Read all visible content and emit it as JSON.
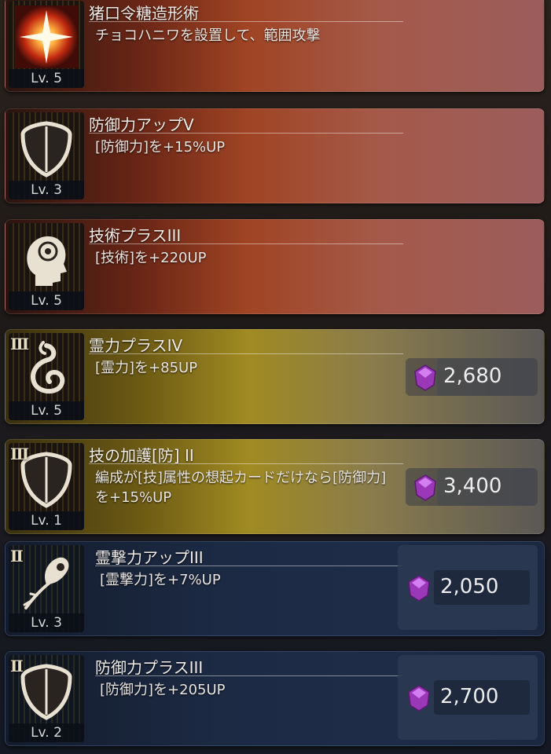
{
  "skills": [
    {
      "name": "猪口令糖造形術",
      "desc": "チョコハニワを設置して、範囲攻撃",
      "level": "Lv. 5",
      "rank": "",
      "cost": "",
      "theme": "red",
      "icon": "burst-icon"
    },
    {
      "name": "防御力アップV",
      "desc": "[防御力]を+15%UP",
      "level": "Lv. 3",
      "rank": "",
      "cost": "",
      "theme": "red",
      "icon": "shield-icon"
    },
    {
      "name": "技術プラスIII",
      "desc": "[技術]を+220UP",
      "level": "Lv. 5",
      "rank": "",
      "cost": "",
      "theme": "red",
      "icon": "head-icon"
    },
    {
      "name": "霊力プラスIV",
      "desc": "[霊力]を+85UP",
      "level": "Lv. 5",
      "rank": "III",
      "cost": "2,680",
      "theme": "gold",
      "icon": "spirit-swirl-icon"
    },
    {
      "name": "技の加護[防] II",
      "desc": "編成が[技]属性の想起カードだけなら[防御力]を+15%UP",
      "level": "Lv. 1",
      "rank": "III",
      "cost": "3,400",
      "theme": "gold",
      "icon": "shield-icon"
    },
    {
      "name": "霊撃力アップIII",
      "desc": "[霊撃力]を+7%UP",
      "level": "Lv. 3",
      "rank": "II",
      "cost": "2,050",
      "theme": "blue",
      "icon": "spirit-blast-icon"
    },
    {
      "name": "防御力プラスIII",
      "desc": "[防御力]を+205UP",
      "level": "Lv. 2",
      "rank": "II",
      "cost": "2,700",
      "theme": "blue",
      "icon": "shield-icon"
    }
  ],
  "colors": {
    "gem": "#a040c0",
    "gem_highlight": "#e090ff",
    "icon_stroke": "#e8e0d0"
  }
}
